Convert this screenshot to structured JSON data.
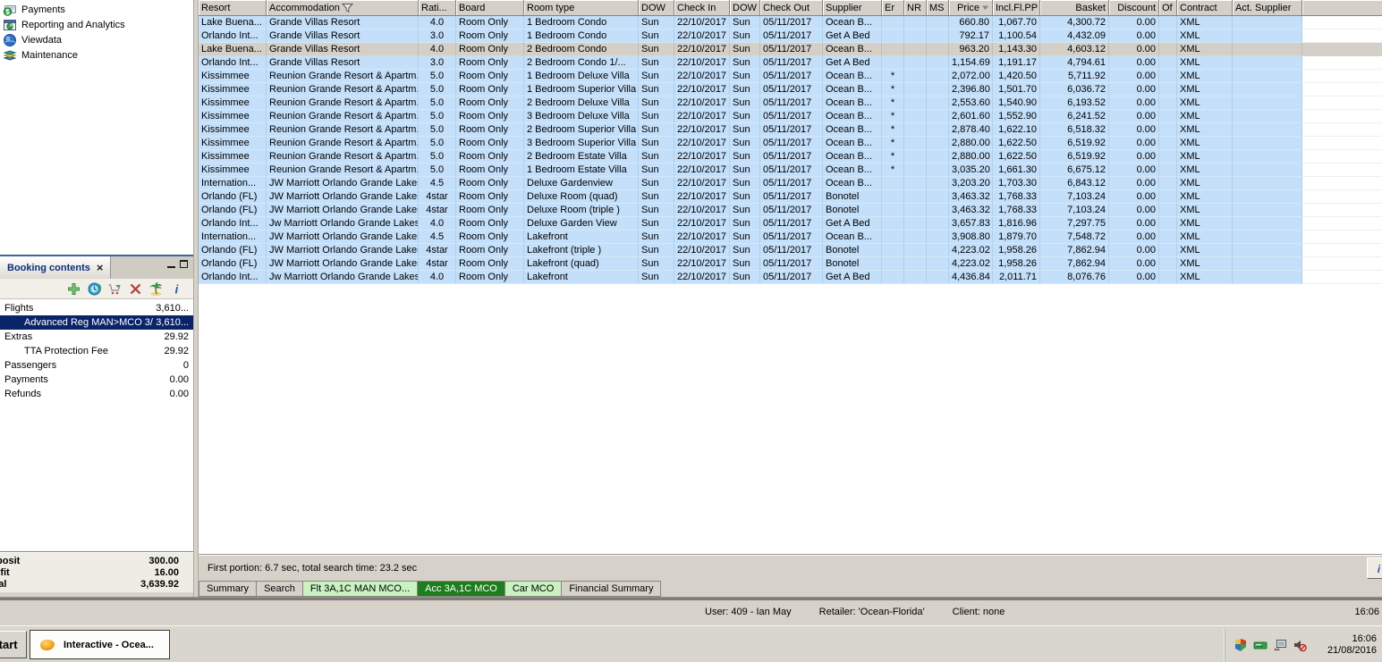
{
  "sidebar": {
    "items": [
      {
        "id": "payments",
        "label": "Payments",
        "icon": "payments-icon"
      },
      {
        "id": "reporting-and-analytics",
        "label": "Reporting and Analytics",
        "icon": "reporting-icon"
      },
      {
        "id": "viewdata",
        "label": "Viewdata",
        "icon": "viewdata-icon"
      },
      {
        "id": "maintenance",
        "label": "Maintenance",
        "icon": "maintenance-icon"
      }
    ]
  },
  "booking_panel": {
    "title": "Booking contents",
    "close_glyph": "×",
    "toolbar_icons": [
      "add-icon",
      "web-refresh-icon",
      "cart-icon",
      "delete-icon",
      "holiday-icon",
      "info-icon"
    ],
    "items": [
      {
        "label": "Flights",
        "value": "3,610...",
        "indent": 0,
        "selected": false
      },
      {
        "label": "Advanced Reg MAN>MCO  3/",
        "value": "3,610...",
        "indent": 1,
        "selected": true
      },
      {
        "label": "Extras",
        "value": "29.92",
        "indent": 0,
        "selected": false
      },
      {
        "label": "TTA Protection Fee",
        "value": "29.92",
        "indent": 1,
        "selected": false
      },
      {
        "label": "Passengers",
        "value": "0",
        "indent": 0,
        "selected": false
      },
      {
        "label": "Payments",
        "value": "0.00",
        "indent": 0,
        "selected": false
      },
      {
        "label": "Refunds",
        "value": "0.00",
        "indent": 0,
        "selected": false
      }
    ],
    "totals": [
      {
        "label": "Deposit",
        "value": "300.00"
      },
      {
        "label": "Profit",
        "value": "16.00"
      },
      {
        "label": "Total",
        "value": "3,639.92"
      }
    ]
  },
  "results_table": {
    "columns": [
      {
        "label": "Resort"
      },
      {
        "label": "Accommodation",
        "icon": "filter-icon"
      },
      {
        "label": "Rati..."
      },
      {
        "label": "Board"
      },
      {
        "label": "Room type"
      },
      {
        "label": "DOW"
      },
      {
        "label": "Check In"
      },
      {
        "label": "DOW"
      },
      {
        "label": "Check Out"
      },
      {
        "label": "Supplier"
      },
      {
        "label": "Er"
      },
      {
        "label": "NR"
      },
      {
        "label": "MS"
      },
      {
        "label": "Price",
        "icon": "sort-icon"
      },
      {
        "label": "Incl.Fl.PP"
      },
      {
        "label": "Basket"
      },
      {
        "label": "Discount"
      },
      {
        "label": "Of"
      },
      {
        "label": "Contract"
      },
      {
        "label": "Act. Supplier"
      }
    ],
    "selected_row_index": 2,
    "rows": [
      [
        "Lake Buena...",
        "Grande Villas Resort",
        "4.0",
        "Room Only",
        "1 Bedroom Condo",
        "Sun",
        "22/10/2017",
        "Sun",
        "05/11/2017",
        "Ocean B...",
        "",
        "",
        "",
        "660.80",
        "1,067.70",
        "4,300.72",
        "0.00",
        "",
        "XML",
        ""
      ],
      [
        "Orlando Int...",
        "Grande Villas Resort",
        "3.0",
        "Room Only",
        "1 Bedroom Condo",
        "Sun",
        "22/10/2017",
        "Sun",
        "05/11/2017",
        "Get A Bed",
        "",
        "",
        "",
        "792.17",
        "1,100.54",
        "4,432.09",
        "0.00",
        "",
        "XML",
        ""
      ],
      [
        "Lake Buena...",
        "Grande Villas Resort",
        "4.0",
        "Room Only",
        "2 Bedroom Condo",
        "Sun",
        "22/10/2017",
        "Sun",
        "05/11/2017",
        "Ocean B...",
        "",
        "",
        "",
        "963.20",
        "1,143.30",
        "4,603.12",
        "0.00",
        "",
        "XML",
        ""
      ],
      [
        "Orlando Int...",
        "Grande Villas Resort",
        "3.0",
        "Room Only",
        "2 Bedroom Condo 1/...",
        "Sun",
        "22/10/2017",
        "Sun",
        "05/11/2017",
        "Get A Bed",
        "",
        "",
        "",
        "1,154.69",
        "1,191.17",
        "4,794.61",
        "0.00",
        "",
        "XML",
        ""
      ],
      [
        "Kissimmee",
        "Reunion Grande Resort & Apartm...",
        "5.0",
        "Room Only",
        "1 Bedroom Deluxe Villa",
        "Sun",
        "22/10/2017",
        "Sun",
        "05/11/2017",
        "Ocean B...",
        "*",
        "",
        "",
        "2,072.00",
        "1,420.50",
        "5,711.92",
        "0.00",
        "",
        "XML",
        ""
      ],
      [
        "Kissimmee",
        "Reunion Grande Resort & Apartm...",
        "5.0",
        "Room Only",
        "1 Bedroom Superior Villa",
        "Sun",
        "22/10/2017",
        "Sun",
        "05/11/2017",
        "Ocean B...",
        "*",
        "",
        "",
        "2,396.80",
        "1,501.70",
        "6,036.72",
        "0.00",
        "",
        "XML",
        ""
      ],
      [
        "Kissimmee",
        "Reunion Grande Resort & Apartm...",
        "5.0",
        "Room Only",
        "2 Bedroom Deluxe Villa",
        "Sun",
        "22/10/2017",
        "Sun",
        "05/11/2017",
        "Ocean B...",
        "*",
        "",
        "",
        "2,553.60",
        "1,540.90",
        "6,193.52",
        "0.00",
        "",
        "XML",
        ""
      ],
      [
        "Kissimmee",
        "Reunion Grande Resort & Apartm...",
        "5.0",
        "Room Only",
        "3 Bedroom Deluxe Villa",
        "Sun",
        "22/10/2017",
        "Sun",
        "05/11/2017",
        "Ocean B...",
        "*",
        "",
        "",
        "2,601.60",
        "1,552.90",
        "6,241.52",
        "0.00",
        "",
        "XML",
        ""
      ],
      [
        "Kissimmee",
        "Reunion Grande Resort & Apartm...",
        "5.0",
        "Room Only",
        "2 Bedroom Superior Villa",
        "Sun",
        "22/10/2017",
        "Sun",
        "05/11/2017",
        "Ocean B...",
        "*",
        "",
        "",
        "2,878.40",
        "1,622.10",
        "6,518.32",
        "0.00",
        "",
        "XML",
        ""
      ],
      [
        "Kissimmee",
        "Reunion Grande Resort & Apartm...",
        "5.0",
        "Room Only",
        "3 Bedroom Superior Villa",
        "Sun",
        "22/10/2017",
        "Sun",
        "05/11/2017",
        "Ocean B...",
        "*",
        "",
        "",
        "2,880.00",
        "1,622.50",
        "6,519.92",
        "0.00",
        "",
        "XML",
        ""
      ],
      [
        "Kissimmee",
        "Reunion Grande Resort & Apartm...",
        "5.0",
        "Room Only",
        "2 Bedroom Estate Villa",
        "Sun",
        "22/10/2017",
        "Sun",
        "05/11/2017",
        "Ocean B...",
        "*",
        "",
        "",
        "2,880.00",
        "1,622.50",
        "6,519.92",
        "0.00",
        "",
        "XML",
        ""
      ],
      [
        "Kissimmee",
        "Reunion Grande Resort & Apartm...",
        "5.0",
        "Room Only",
        "1 Bedroom Estate Villa",
        "Sun",
        "22/10/2017",
        "Sun",
        "05/11/2017",
        "Ocean B...",
        "*",
        "",
        "",
        "3,035.20",
        "1,661.30",
        "6,675.12",
        "0.00",
        "",
        "XML",
        ""
      ],
      [
        "Internation...",
        "JW Marriott Orlando Grande Lakes",
        "4.5",
        "Room Only",
        "Deluxe Gardenview",
        "Sun",
        "22/10/2017",
        "Sun",
        "05/11/2017",
        "Ocean B...",
        "",
        "",
        "",
        "3,203.20",
        "1,703.30",
        "6,843.12",
        "0.00",
        "",
        "XML",
        ""
      ],
      [
        "Orlando (FL)",
        "JW Marriott Orlando Grande Lakes",
        "4star",
        "Room Only",
        "Deluxe Room (quad)",
        "Sun",
        "22/10/2017",
        "Sun",
        "05/11/2017",
        "Bonotel",
        "",
        "",
        "",
        "3,463.32",
        "1,768.33",
        "7,103.24",
        "0.00",
        "",
        "XML",
        ""
      ],
      [
        "Orlando (FL)",
        "JW Marriott Orlando Grande Lakes",
        "4star",
        "Room Only",
        "Deluxe Room (triple )",
        "Sun",
        "22/10/2017",
        "Sun",
        "05/11/2017",
        "Bonotel",
        "",
        "",
        "",
        "3,463.32",
        "1,768.33",
        "7,103.24",
        "0.00",
        "",
        "XML",
        ""
      ],
      [
        "Orlando Int...",
        "Jw Marriott Orlando Grande Lakes",
        "4.0",
        "Room Only",
        "Deluxe Garden View",
        "Sun",
        "22/10/2017",
        "Sun",
        "05/11/2017",
        "Get A Bed",
        "",
        "",
        "",
        "3,657.83",
        "1,816.96",
        "7,297.75",
        "0.00",
        "",
        "XML",
        ""
      ],
      [
        "Internation...",
        "JW Marriott Orlando Grande Lakes",
        "4.5",
        "Room Only",
        "Lakefront",
        "Sun",
        "22/10/2017",
        "Sun",
        "05/11/2017",
        "Ocean B...",
        "",
        "",
        "",
        "3,908.80",
        "1,879.70",
        "7,548.72",
        "0.00",
        "",
        "XML",
        ""
      ],
      [
        "Orlando (FL)",
        "JW Marriott Orlando Grande Lakes",
        "4star",
        "Room Only",
        "Lakefront (triple )",
        "Sun",
        "22/10/2017",
        "Sun",
        "05/11/2017",
        "Bonotel",
        "",
        "",
        "",
        "4,223.02",
        "1,958.26",
        "7,862.94",
        "0.00",
        "",
        "XML",
        ""
      ],
      [
        "Orlando (FL)",
        "JW Marriott Orlando Grande Lakes",
        "4star",
        "Room Only",
        "Lakefront (quad)",
        "Sun",
        "22/10/2017",
        "Sun",
        "05/11/2017",
        "Bonotel",
        "",
        "",
        "",
        "4,223.02",
        "1,958.26",
        "7,862.94",
        "0.00",
        "",
        "XML",
        ""
      ],
      [
        "Orlando Int...",
        "Jw Marriott Orlando Grande Lakes",
        "4.0",
        "Room Only",
        "Lakefront",
        "Sun",
        "22/10/2017",
        "Sun",
        "05/11/2017",
        "Get A Bed",
        "",
        "",
        "",
        "4,436.84",
        "2,011.71",
        "8,076.76",
        "0.00",
        "",
        "XML",
        ""
      ]
    ]
  },
  "search_status": {
    "text": "First portion: 6.7 sec, total search time: 23.2 sec"
  },
  "result_tabs": [
    {
      "label": "Summary",
      "style": "plain"
    },
    {
      "label": "Search",
      "style": "plain"
    },
    {
      "label": "Flt 3A,1C MAN MCO...",
      "style": "green-light"
    },
    {
      "label": "Acc 3A,1C MCO",
      "style": "green-active"
    },
    {
      "label": "Car MCO",
      "style": "green-light"
    },
    {
      "label": "Financial Summary",
      "style": "plain"
    }
  ],
  "app_status": {
    "user": "User: 409 - Ian May",
    "retailer": "Retailer: 'Ocean-Florida'",
    "client": "Client: none",
    "time": "16:06"
  },
  "taskbar": {
    "start_label": "Start",
    "window_button": {
      "label": "Interactive - Ocea...",
      "icon": "app-orange-icon"
    },
    "tray_icons": [
      "antivirus-icon",
      "card-icon",
      "network-icon",
      "volume-muted-icon"
    ],
    "clock_time": "16:06",
    "clock_date": "21/08/2016"
  },
  "colors": {
    "row_blue": "#C3DFF9",
    "selected_row_gray": "#D4D0C8",
    "selection_navy": "#0A246A",
    "tab_green_active": "#1E7D1E",
    "tab_green_light": "#C9F2C0",
    "header_gray": "#D4D0C8"
  }
}
